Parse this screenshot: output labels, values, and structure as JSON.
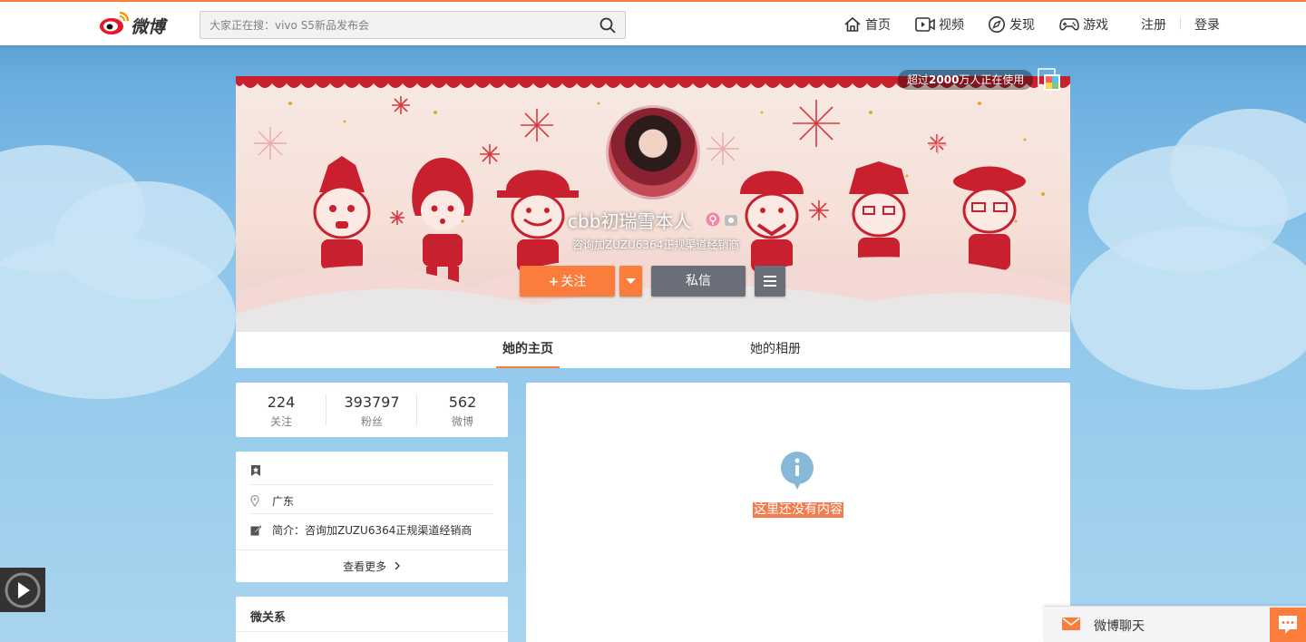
{
  "topbar": {
    "logo_text": "微博",
    "search_placeholder": "大家正在搜：vivo S5新品发布会",
    "nav": [
      {
        "label": "首页",
        "icon": "home-icon"
      },
      {
        "label": "视频",
        "icon": "video-icon"
      },
      {
        "label": "发现",
        "icon": "compass-icon"
      },
      {
        "label": "游戏",
        "icon": "gamepad-icon"
      }
    ],
    "register": "注册",
    "login": "登录"
  },
  "profile": {
    "usage_badge_prefix": "超过",
    "usage_badge_count": "2000",
    "usage_badge_suffix": "万人正在使用",
    "username": "cbb初瑞雪本人",
    "bio_line": "咨询加ZUZU6364正规渠道经销商",
    "follow_label": "关注",
    "message_label": "私信"
  },
  "tabs": [
    {
      "label": "她的主页",
      "active": true
    },
    {
      "label": "她的相册",
      "active": false
    }
  ],
  "stats": [
    {
      "value": "224",
      "label": "关注"
    },
    {
      "value": "393797",
      "label": "粉丝"
    },
    {
      "value": "562",
      "label": "微博"
    }
  ],
  "info": {
    "location": "广东",
    "bio_prefix": "简介：",
    "bio": "咨询加ZUZU6364正规渠道经销商",
    "more_label": "查看更多"
  },
  "relations": {
    "title": "微关系"
  },
  "feed": {
    "empty_text": "这里还没有内容"
  },
  "chat": {
    "label": "微博聊天"
  },
  "colors": {
    "accent": "#fa7d3c",
    "button_gray": "#696e78",
    "banner_red": "#c8202f"
  }
}
